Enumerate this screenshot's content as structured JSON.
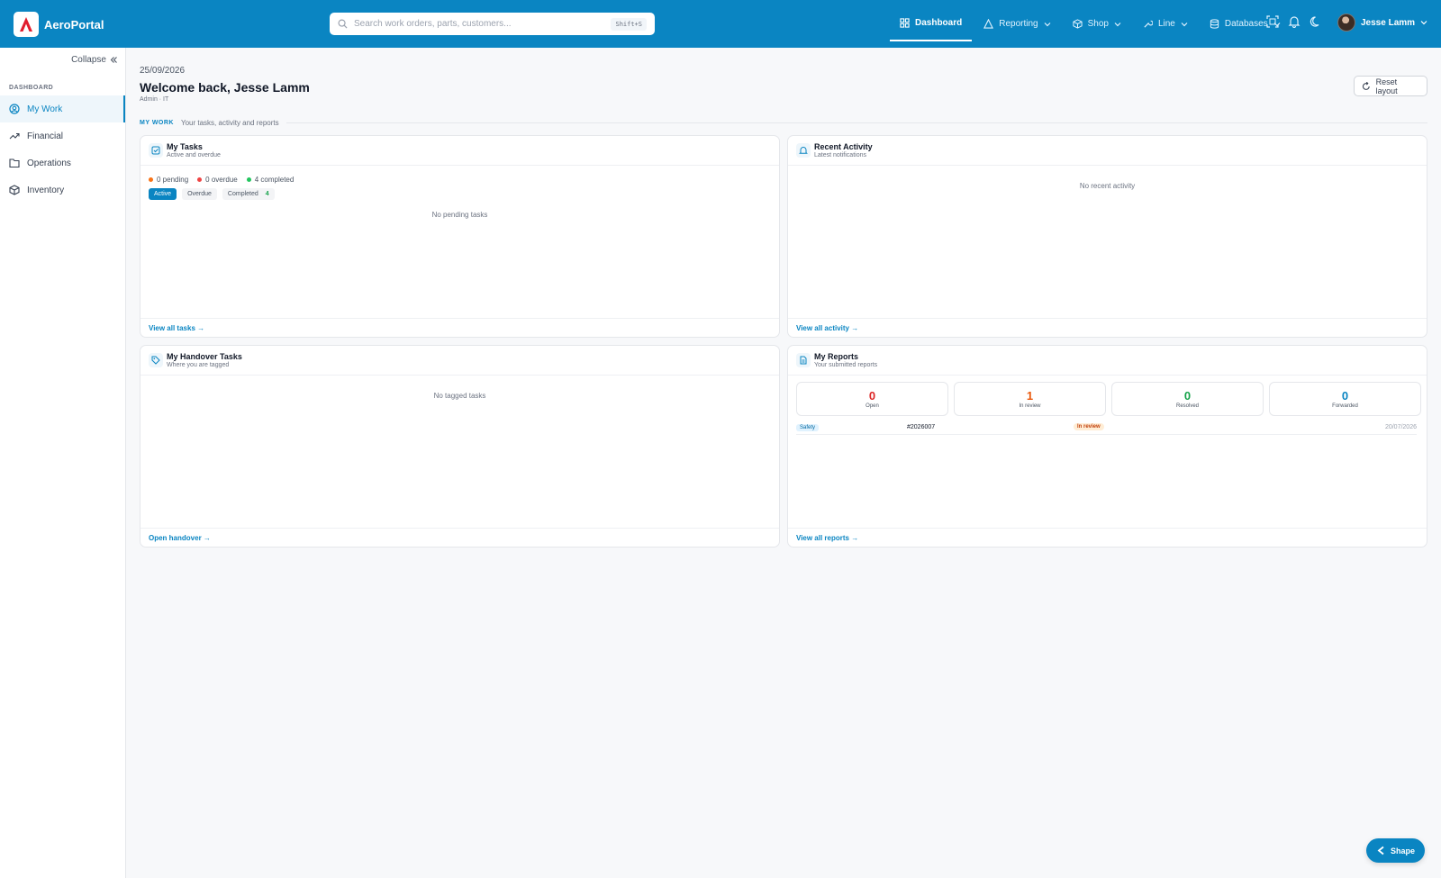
{
  "app": {
    "name": "AeroPortal"
  },
  "search": {
    "placeholder": "Search work orders, parts, customers...",
    "shortcut": "Shift+S"
  },
  "nav": [
    {
      "label": "Dashboard",
      "icon": "dashboard-icon"
    },
    {
      "label": "Reporting",
      "icon": "warning-triangle-icon"
    },
    {
      "label": "Shop",
      "icon": "box-icon"
    },
    {
      "label": "Line",
      "icon": "wrench-icon"
    },
    {
      "label": "Databases",
      "icon": "database-icon"
    }
  ],
  "user": {
    "name": "Jesse Lamm"
  },
  "sidebar": {
    "collapse_label": "Collapse",
    "section": "DASHBOARD",
    "items": [
      {
        "label": "My Work",
        "icon": "user-circle-icon",
        "active": true
      },
      {
        "label": "Financial",
        "icon": "trend-up-icon"
      },
      {
        "label": "Operations",
        "icon": "folder-icon"
      },
      {
        "label": "Inventory",
        "icon": "cube-icon"
      }
    ]
  },
  "header": {
    "date": "25/09/2026",
    "welcome": "Welcome back, Jesse Lamm",
    "role": "Admin · IT",
    "reset_label": "Reset layout"
  },
  "section": {
    "label": "MY WORK",
    "subtitle": "Your tasks, activity and reports"
  },
  "tasks": {
    "title": "My Tasks",
    "subtitle": "Active and overdue",
    "stats": [
      {
        "label": "0 pending",
        "color": "#f97316"
      },
      {
        "label": "0 overdue",
        "color": "#ef4444"
      },
      {
        "label": "4 completed",
        "color": "#22c55e"
      }
    ],
    "filters": {
      "active": "Active",
      "overdue": "Overdue",
      "completed": "Completed",
      "completed_count": "4"
    },
    "empty": "No pending tasks",
    "link": "View all tasks →"
  },
  "activity": {
    "title": "Recent Activity",
    "subtitle": "Latest notifications",
    "empty": "No recent activity",
    "link": "View all activity →"
  },
  "handover": {
    "title": "My Handover Tasks",
    "subtitle": "Where you are tagged",
    "empty": "No tagged tasks",
    "link": "Open handover →"
  },
  "reports": {
    "title": "My Reports",
    "subtitle": "Your submitted reports",
    "stats": [
      {
        "value": "0",
        "label": "Open",
        "color": "#dc2626"
      },
      {
        "value": "1",
        "label": "In review",
        "color": "#ea580c"
      },
      {
        "value": "0",
        "label": "Resolved",
        "color": "#16a34a"
      },
      {
        "value": "0",
        "label": "Forwarded",
        "color": "#0a85c2"
      }
    ],
    "row": {
      "category": "Safety",
      "id": "#2026007",
      "status": "In review",
      "date": "20/07/2026"
    },
    "link": "View all reports →"
  },
  "fab": {
    "label": "Shape"
  },
  "colors": {
    "brand": "#0a85c2",
    "logo_red": "#e11d2e"
  }
}
